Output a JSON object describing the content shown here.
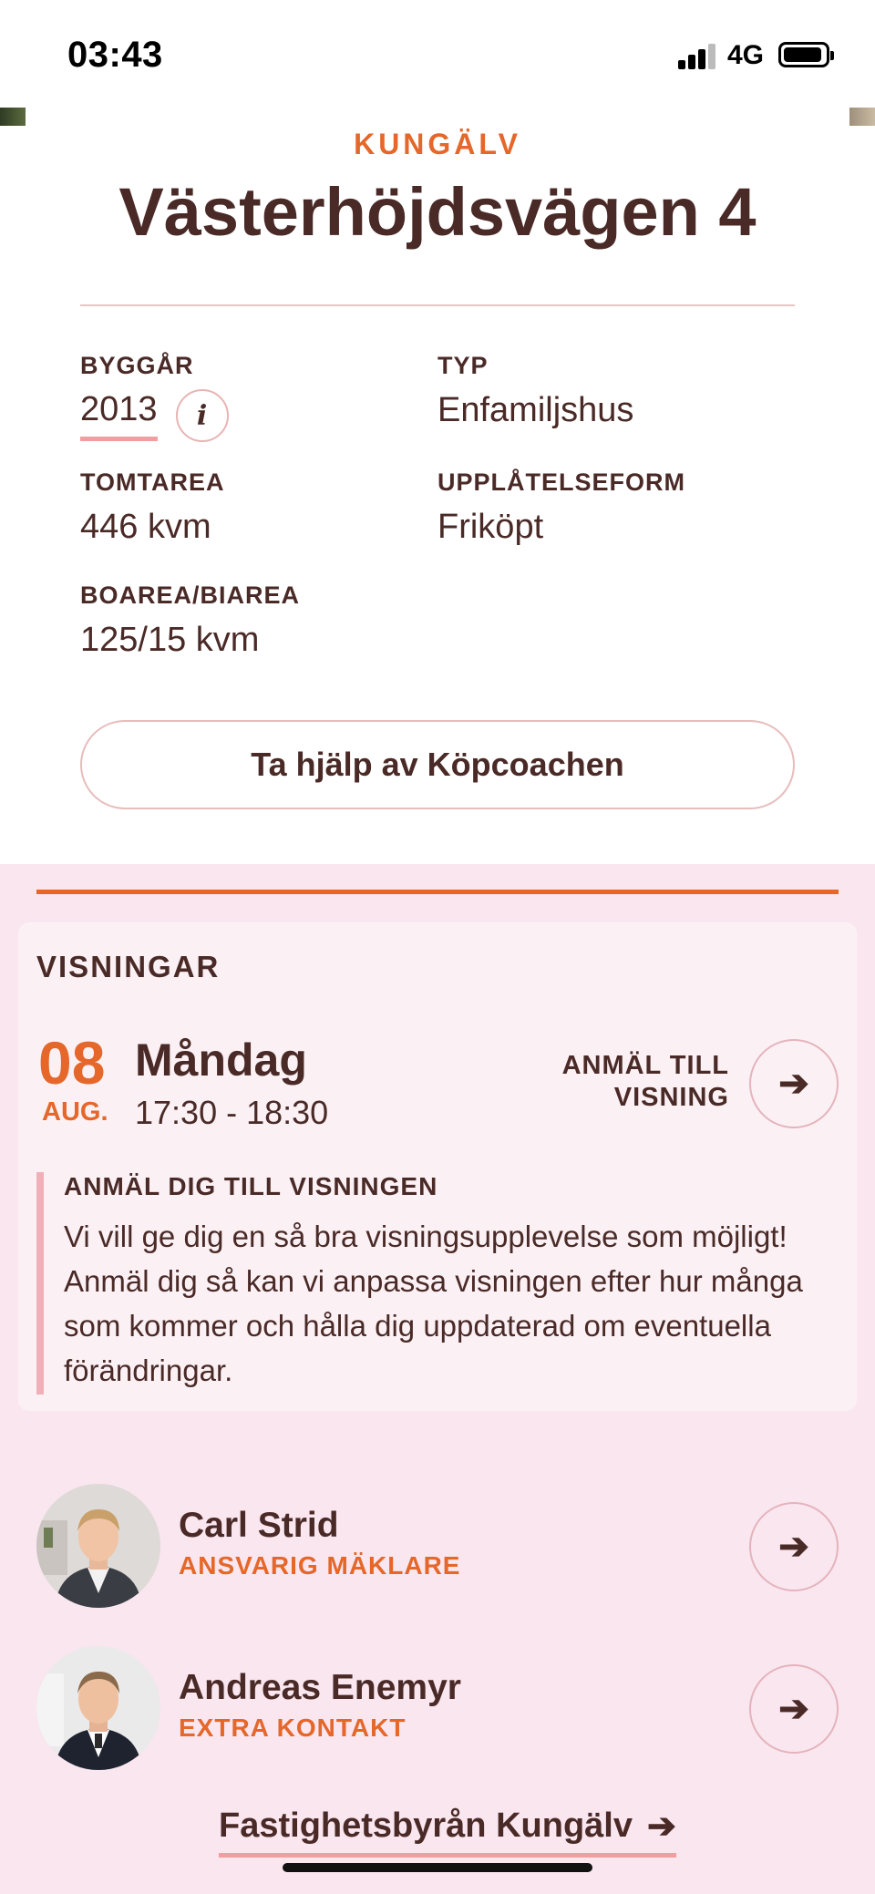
{
  "status_bar": {
    "time": "03:43",
    "network": "4G"
  },
  "listing": {
    "city": "KUNGÄLV",
    "address": "Västerhöjdsvägen 4"
  },
  "facts": {
    "build_year": {
      "label": "BYGGÅR",
      "value": "2013",
      "info_icon": "i"
    },
    "type": {
      "label": "TYP",
      "value": "Enfamiljshus"
    },
    "plot_area": {
      "label": "TOMTAREA",
      "value": "446 kvm"
    },
    "tenure": {
      "label": "UPPLÅTELSEFORM",
      "value": "Friköpt"
    },
    "living_area": {
      "label": "BOAREA/BIAREA",
      "value": "125/15 kvm"
    }
  },
  "coach_button": {
    "label": "Ta hjälp av Köpcoachen"
  },
  "showings": {
    "title": "VISNINGAR",
    "date_day": "08",
    "date_month": "AUG.",
    "weekday": "Måndag",
    "time_range": "17:30 - 18:30",
    "register_line1": "ANMÄL TILL",
    "register_line2": "VISNING",
    "arrow": "➔",
    "notice": {
      "title": "ANMÄL DIG TILL VISNINGEN",
      "text": "Vi vill ge dig en så bra visningsupplevelse som möjligt! Anmäl dig så kan vi anpassa visningen efter hur många som kommer och hålla dig uppdaterad om eventuella förändringar."
    }
  },
  "agents": [
    {
      "name": "Carl Strid",
      "role": "ANSVARIG MÄKLARE",
      "arrow": "➔"
    },
    {
      "name": "Andreas Enemyr",
      "role": "EXTRA KONTAKT",
      "arrow": "➔"
    }
  ],
  "office_link": {
    "label": "Fastighetsbyrån Kungälv",
    "arrow": "➔"
  },
  "colors": {
    "accent_orange": "#e5672a",
    "text_brown": "#4a2a27",
    "pink_background": "#f9e6ef",
    "pink_underline": "#ef9f9f"
  }
}
